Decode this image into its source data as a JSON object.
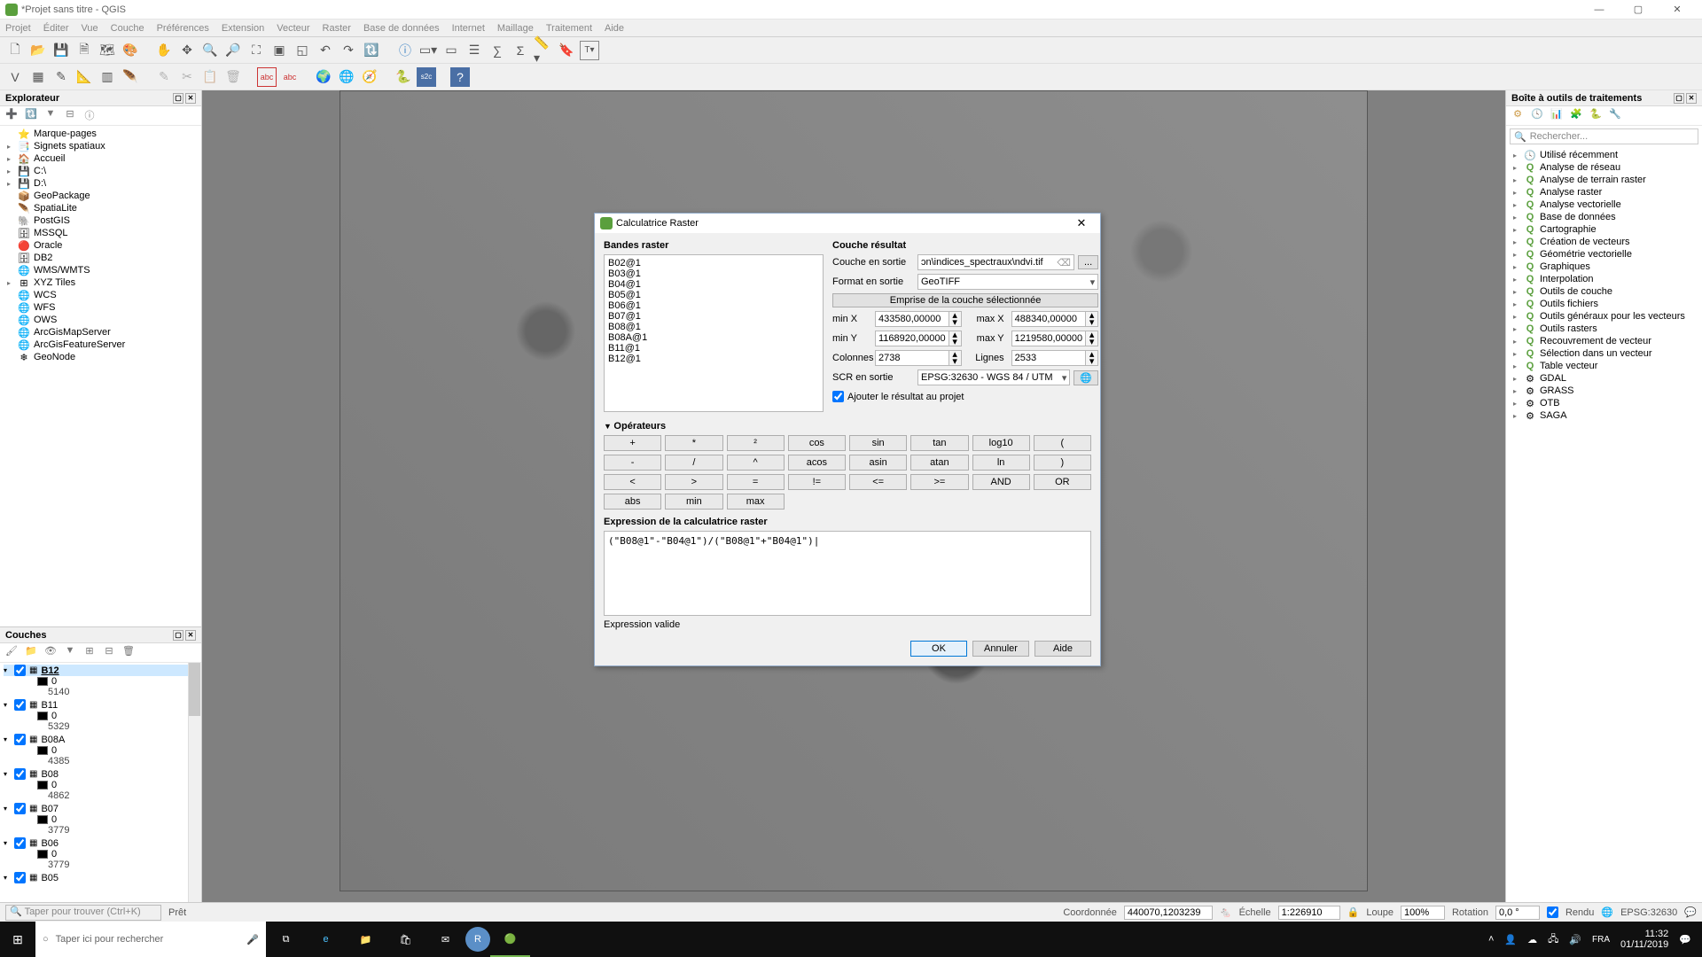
{
  "window": {
    "title": "*Projet sans titre - QGIS"
  },
  "menu": [
    "Projet",
    "Éditer",
    "Vue",
    "Couche",
    "Préférences",
    "Extension",
    "Vecteur",
    "Raster",
    "Base de données",
    "Internet",
    "Maillage",
    "Traitement",
    "Aide"
  ],
  "explorer": {
    "title": "Explorateur",
    "items": [
      {
        "ic": "⭐",
        "label": "Marque-pages"
      },
      {
        "ic": "📑",
        "label": "Signets spatiaux",
        "exp": "▸"
      },
      {
        "ic": "🏠",
        "label": "Accueil",
        "exp": "▸"
      },
      {
        "ic": "💾",
        "label": "C:\\",
        "exp": "▸"
      },
      {
        "ic": "💾",
        "label": "D:\\",
        "exp": "▸"
      },
      {
        "ic": "📦",
        "label": "GeoPackage"
      },
      {
        "ic": "🪶",
        "label": "SpatiaLite"
      },
      {
        "ic": "🐘",
        "label": "PostGIS"
      },
      {
        "ic": "🗄",
        "label": "MSSQL"
      },
      {
        "ic": "🔴",
        "label": "Oracle"
      },
      {
        "ic": "🗄",
        "label": "DB2"
      },
      {
        "ic": "🌐",
        "label": "WMS/WMTS"
      },
      {
        "ic": "⊞",
        "label": "XYZ Tiles",
        "exp": "▸"
      },
      {
        "ic": "🌐",
        "label": "WCS"
      },
      {
        "ic": "🌐",
        "label": "WFS"
      },
      {
        "ic": "🌐",
        "label": "OWS"
      },
      {
        "ic": "🌐",
        "label": "ArcGisMapServer"
      },
      {
        "ic": "🌐",
        "label": "ArcGisFeatureServer"
      },
      {
        "ic": "❄",
        "label": "GeoNode"
      }
    ]
  },
  "layers": {
    "title": "Couches",
    "items": [
      {
        "name": "B12",
        "vmin": "0",
        "vmax": "5140",
        "sel": true,
        "bold": true
      },
      {
        "name": "B11",
        "vmin": "0",
        "vmax": "5329"
      },
      {
        "name": "B08A",
        "vmin": "0",
        "vmax": "4385"
      },
      {
        "name": "B08",
        "vmin": "0",
        "vmax": "4862"
      },
      {
        "name": "B07",
        "vmin": "0",
        "vmax": "3779"
      },
      {
        "name": "B06",
        "vmin": "0",
        "vmax": "3779"
      },
      {
        "name": "B05",
        "vmin": "",
        "vmax": ""
      }
    ]
  },
  "toolbox": {
    "title": "Boîte à outils de traitements",
    "search_ph": "Rechercher...",
    "items": [
      "Utilisé récemment",
      "Analyse de réseau",
      "Analyse de terrain raster",
      "Analyse raster",
      "Analyse vectorielle",
      "Base de données",
      "Cartographie",
      "Création de vecteurs",
      "Géométrie vectorielle",
      "Graphiques",
      "Interpolation",
      "Outils de couche",
      "Outils fichiers",
      "Outils généraux pour les vecteurs",
      "Outils rasters",
      "Recouvrement de vecteur",
      "Sélection dans un vecteur",
      "Table vecteur",
      "GDAL",
      "GRASS",
      "OTB",
      "SAGA"
    ]
  },
  "dialog": {
    "title": "Calculatrice Raster",
    "bands_h": "Bandes raster",
    "bands": [
      "B02@1",
      "B03@1",
      "B04@1",
      "B05@1",
      "B06@1",
      "B07@1",
      "B08@1",
      "B08A@1",
      "B11@1",
      "B12@1"
    ],
    "result_h": "Couche résultat",
    "out_layer_lbl": "Couche en sortie",
    "out_layer": "ɔn\\indices_spectraux\\ndvi.tif",
    "out_fmt_lbl": "Format en sortie",
    "out_fmt": "GeoTIFF",
    "extent_btn": "Emprise de la couche sélectionnée",
    "minx_lbl": "min X",
    "minx": "433580,00000",
    "maxx_lbl": "max X",
    "maxx": "488340,00000",
    "miny_lbl": "min Y",
    "miny": "1168920,00000",
    "maxy_lbl": "max Y",
    "maxy": "1219580,00000",
    "cols_lbl": "Colonnes",
    "cols": "2738",
    "rows_lbl": "Lignes",
    "rows": "2533",
    "crs_lbl": "SCR en sortie",
    "crs": "EPSG:32630 - WGS 84 / UTM",
    "add_lbl": "Ajouter le résultat au projet",
    "ops_h": "Opérateurs",
    "ops": [
      "+",
      "*",
      "²",
      "cos",
      "sin",
      "tan",
      "log10",
      "(",
      "-",
      "/",
      "^",
      "acos",
      "asin",
      "atan",
      "ln",
      ")",
      "<",
      ">",
      "=",
      "!=",
      "<=",
      ">=",
      "AND",
      "OR",
      "abs",
      "min",
      "max"
    ],
    "expr_h": "Expression de la calculatrice raster",
    "expr": "(\"B08@1\"-\"B04@1\")/(\"B08@1\"+\"B04@1\")|",
    "valid": "Expression valide",
    "ok": "OK",
    "cancel": "Annuler",
    "help": "Aide"
  },
  "status": {
    "find_ph": "Taper pour trouver (Ctrl+K)",
    "ready": "Prêt",
    "coord_lbl": "Coordonnée",
    "coord": "440070,1203239",
    "scale_lbl": "Échelle",
    "scale": "1:226910",
    "mag_lbl": "Loupe",
    "mag": "100%",
    "rot_lbl": "Rotation",
    "rot": "0,0 °",
    "render": "Rendu",
    "crs": "EPSG:32630"
  },
  "taskbar": {
    "search_ph": "Taper ici pour rechercher",
    "time": "11:32",
    "date": "01/11/2019"
  }
}
